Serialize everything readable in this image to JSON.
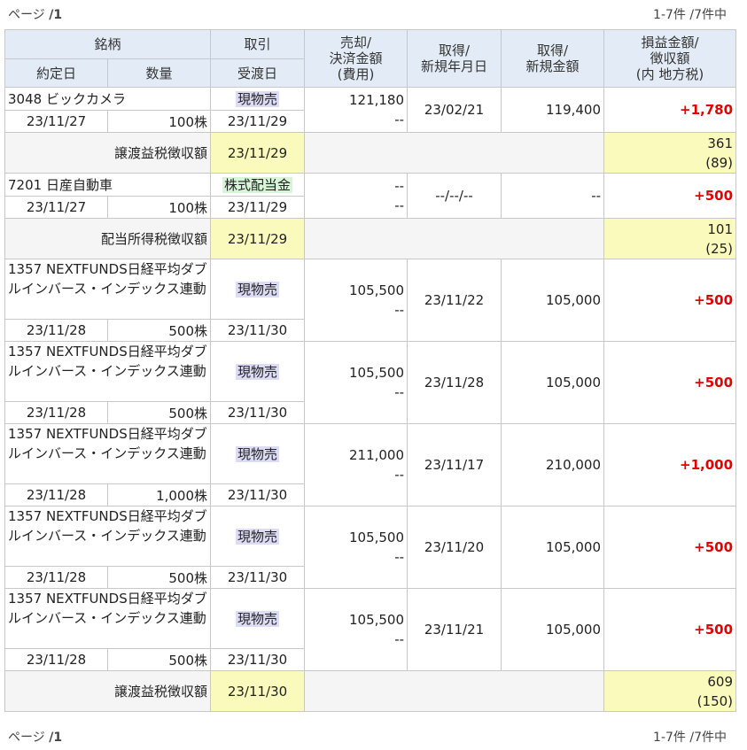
{
  "pager": {
    "label": "ページ",
    "sep": "/",
    "page": "1",
    "range": "1-7件",
    "total": "/7件中"
  },
  "header": {
    "name": "銘柄",
    "trade": "取引",
    "sell_amount": "売却/",
    "settle_amount": "決済金額",
    "fee": "(費用)",
    "acq_date_1": "取得/",
    "acq_date_2": "新規年月日",
    "acq_amount_1": "取得/",
    "acq_amount_2": "新規金額",
    "pl_1": "損益金額/",
    "pl_2": "徴収額",
    "pl_3": "(内 地方税)",
    "contract_date": "約定日",
    "quantity": "数量",
    "delivery_date": "受渡日"
  },
  "trades": [
    {
      "name": "3048 ビックカメラ",
      "type": "現物売",
      "type_kind": "sell",
      "sell": "121,180",
      "fee": "--",
      "acq_date": "23/02/21",
      "acq_amount": "119,400",
      "pl": "+1,780",
      "contract": "23/11/27",
      "qty": "100株",
      "delivery": "23/11/29"
    },
    {
      "name": "7201 日産自動車",
      "type": "株式配当金",
      "type_kind": "div",
      "sell": "--",
      "fee": "--",
      "acq_date": "--/--/--",
      "acq_amount": "--",
      "pl": "+500",
      "contract": "23/11/27",
      "qty": "100株",
      "delivery": "23/11/29"
    },
    {
      "name": "1357 NEXTFUNDS日経平均ダブルインバース・インデックス連動",
      "type": "現物売",
      "type_kind": "sell",
      "sell": "105,500",
      "fee": "--",
      "acq_date": "23/11/22",
      "acq_amount": "105,000",
      "pl": "+500",
      "contract": "23/11/28",
      "qty": "500株",
      "delivery": "23/11/30"
    },
    {
      "name": "1357 NEXTFUNDS日経平均ダブルインバース・インデックス連動",
      "type": "現物売",
      "type_kind": "sell",
      "sell": "105,500",
      "fee": "--",
      "acq_date": "23/11/28",
      "acq_amount": "105,000",
      "pl": "+500",
      "contract": "23/11/28",
      "qty": "500株",
      "delivery": "23/11/30"
    },
    {
      "name": "1357 NEXTFUNDS日経平均ダブルインバース・インデックス連動",
      "type": "現物売",
      "type_kind": "sell",
      "sell": "211,000",
      "fee": "--",
      "acq_date": "23/11/17",
      "acq_amount": "210,000",
      "pl": "+1,000",
      "contract": "23/11/28",
      "qty": "1,000株",
      "delivery": "23/11/30"
    },
    {
      "name": "1357 NEXTFUNDS日経平均ダブルインバース・インデックス連動",
      "type": "現物売",
      "type_kind": "sell",
      "sell": "105,500",
      "fee": "--",
      "acq_date": "23/11/20",
      "acq_amount": "105,000",
      "pl": "+500",
      "contract": "23/11/28",
      "qty": "500株",
      "delivery": "23/11/30"
    },
    {
      "name": "1357 NEXTFUNDS日経平均ダブルインバース・インデックス連動",
      "type": "現物売",
      "type_kind": "sell",
      "sell": "105,500",
      "fee": "--",
      "acq_date": "23/11/21",
      "acq_amount": "105,000",
      "pl": "+500",
      "contract": "23/11/28",
      "qty": "500株",
      "delivery": "23/11/30"
    }
  ],
  "taxes": [
    {
      "label": "譲渡益税徴収額",
      "date": "23/11/29",
      "amount": "361",
      "local": "(89)"
    },
    {
      "label": "配当所得税徴収額",
      "date": "23/11/29",
      "amount": "101",
      "local": "(25)"
    },
    {
      "label": "譲渡益税徴収額",
      "date": "23/11/30",
      "amount": "609",
      "local": "(150)"
    }
  ],
  "colors": {
    "header_bg": "#e3ecf6",
    "highlight": "#fafabc",
    "profit": "#e60000",
    "sell_tag": "#dcdcf5",
    "dividend_tag": "#d7f5d7"
  }
}
